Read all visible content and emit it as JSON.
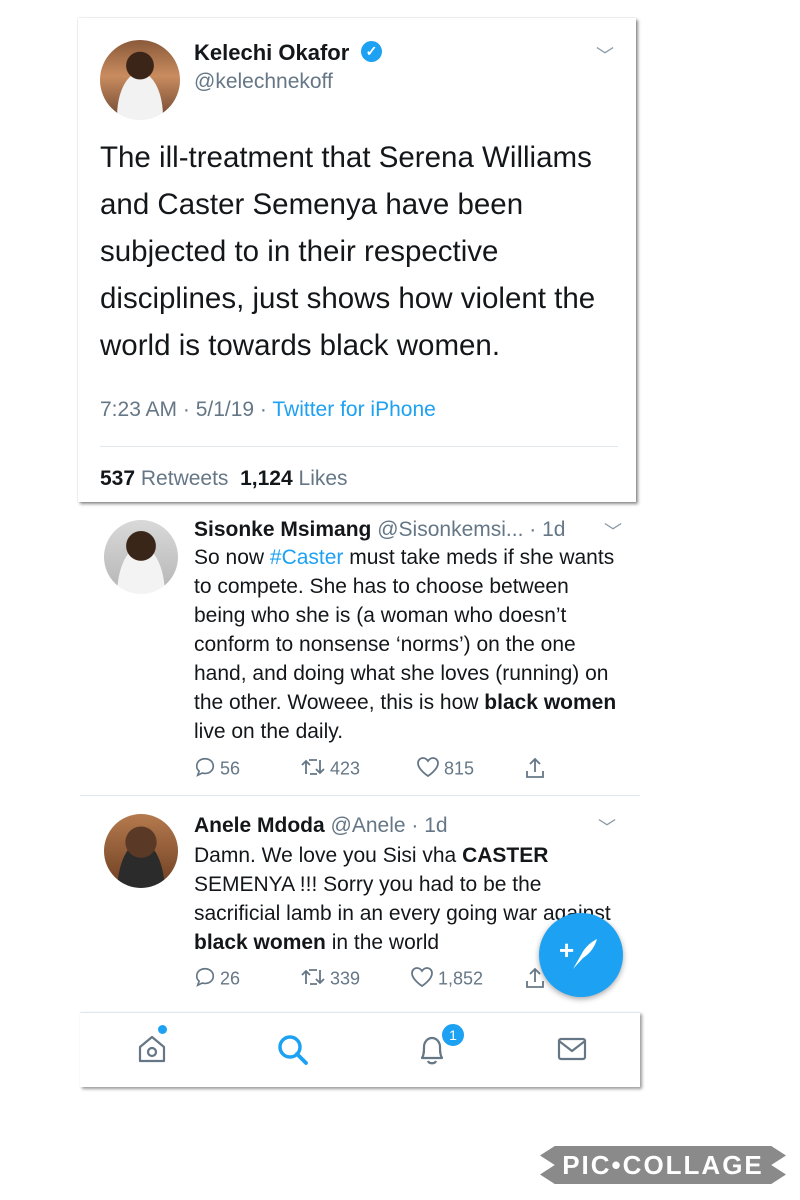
{
  "main_tweet": {
    "name": "Kelechi Okafor",
    "handle": "@kelechnekoff",
    "text": "The ill-treatment that Serena Williams and Caster Semenya have been subjected to in their respective disciplines, just shows how violent the world is towards black women.",
    "timestamp": "7:23 AM · 5/1/19 · ",
    "source": "Twitter for iPhone",
    "retweets_count": "537",
    "retweets_label": "Retweets",
    "likes_count": "1,124",
    "likes_label": "Likes"
  },
  "replies": [
    {
      "name": "Sisonke Msimang",
      "handle_time": "@Sisonkemsi... · 1d",
      "text_1": "So now ",
      "hashtag": "#Caster",
      "text_2": " must take meds if she wants to compete. She has to choose between being who she is (a woman who doesn’t conform to nonsense ‘norms’) on the one hand, and doing what she loves (running) on the other. Woweee, this is how ",
      "bold": "black women",
      "text_3": " live on the daily.",
      "replies": "56",
      "retweets": "423",
      "likes": "815"
    },
    {
      "name": "Anele Mdoda",
      "handle_time": "@Anele · 1d",
      "text_1": "Damn. We love you Sisi vha ",
      "bold_1": "CASTER",
      "text_2": " SEMENYA !!! Sorry you had to be the sacrificial lamb in an every going war against ",
      "bold_2": "black women",
      "text_3": " in the world",
      "replies": "26",
      "retweets": "339",
      "likes": "1,852"
    }
  ],
  "nav": {
    "items": [
      "home-icon",
      "search-icon",
      "notifications-icon",
      "messages-icon"
    ],
    "notification_badge": "1",
    "active": "search"
  },
  "watermark": "PIC•COLLAGE",
  "colors": {
    "accent": "#1da1f2",
    "text": "#14171a",
    "muted": "#657786"
  }
}
